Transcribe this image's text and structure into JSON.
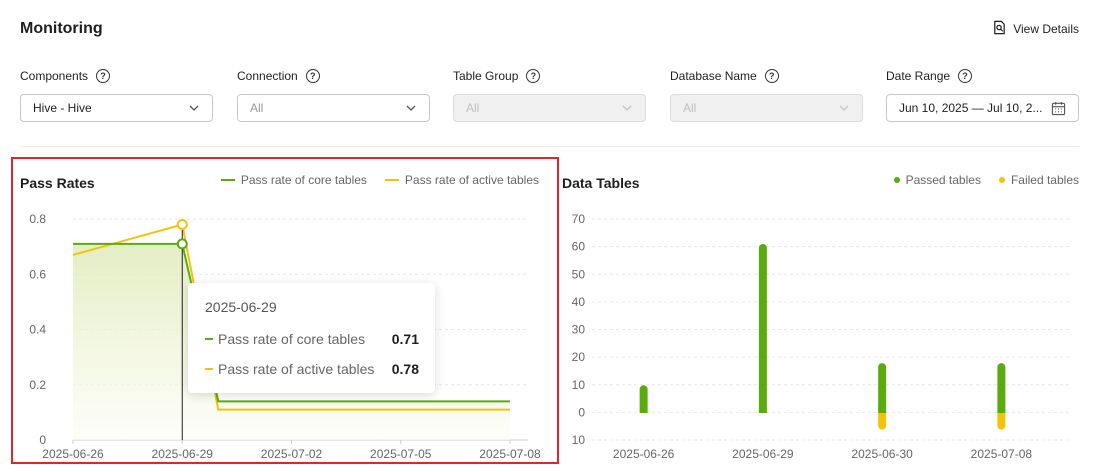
{
  "header": {
    "title": "Monitoring",
    "view_details": "View Details"
  },
  "filters": [
    {
      "label": "Components",
      "value": "Hive - Hive",
      "state": "selected"
    },
    {
      "label": "Connection",
      "value": "All",
      "state": "placeholder"
    },
    {
      "label": "Table Group",
      "value": "All",
      "state": "disabled"
    },
    {
      "label": "Database Name",
      "value": "All",
      "state": "disabled"
    },
    {
      "label": "Date Range",
      "value": "Jun 10, 2025 — Jul 10, 2...",
      "state": "date"
    }
  ],
  "help_glyph": "?",
  "colors": {
    "green": "#5aab0f",
    "yellow": "#f5c20b",
    "highlight_border": "#e0262b"
  },
  "icons": {
    "view_details": "search-document-icon",
    "filter_help": "question-circle-icon",
    "dropdown": "chevron-down-icon",
    "date": "calendar-icon"
  },
  "chart_data": [
    {
      "type": "line",
      "title": "Pass Rates",
      "legend_position": "top-right",
      "x": [
        "2025-06-26",
        "2025-06-29",
        "2025-07-02",
        "2025-07-05",
        "2025-07-08"
      ],
      "x_ticks": [
        "2025-06-26",
        "2025-06-29",
        "2025-07-02",
        "2025-07-05",
        "2025-07-08"
      ],
      "y_ticks": [
        "0",
        "0.2",
        "0.4",
        "0.6",
        "0.8"
      ],
      "ylim": [
        0,
        0.8
      ],
      "grid": true,
      "series": [
        {
          "name": "Pass rate of core tables",
          "color": "#5aab0f",
          "values": [
            0.71,
            0.71,
            0.14,
            0.14,
            0.14
          ]
        },
        {
          "name": "Pass rate of active tables",
          "color": "#f5c20b",
          "values": [
            0.67,
            0.78,
            0.11,
            0.11,
            0.11
          ]
        }
      ],
      "tooltip": {
        "date": "2025-06-29",
        "rows": [
          {
            "label": "Pass rate of core tables",
            "value": "0.71",
            "color": "#5aab0f"
          },
          {
            "label": "Pass rate of active tables",
            "value": "0.78",
            "color": "#f5c20b"
          }
        ]
      }
    },
    {
      "type": "bar",
      "title": "Data Tables",
      "legend_position": "top-right",
      "categories": [
        "2025-06-26",
        "2025-06-29",
        "2025-06-30",
        "2025-07-08"
      ],
      "y_ticks": [
        "70",
        "60",
        "50",
        "40",
        "30",
        "20",
        "10",
        "0",
        "10"
      ],
      "ylim": [
        -10,
        70
      ],
      "grid": true,
      "series": [
        {
          "name": "Passed tables",
          "color": "#5aab0f",
          "values": [
            10,
            61,
            18,
            18
          ]
        },
        {
          "name": "Failed tables",
          "color": "#f5c20b",
          "values": [
            0,
            0,
            -6,
            -6
          ]
        }
      ]
    }
  ]
}
